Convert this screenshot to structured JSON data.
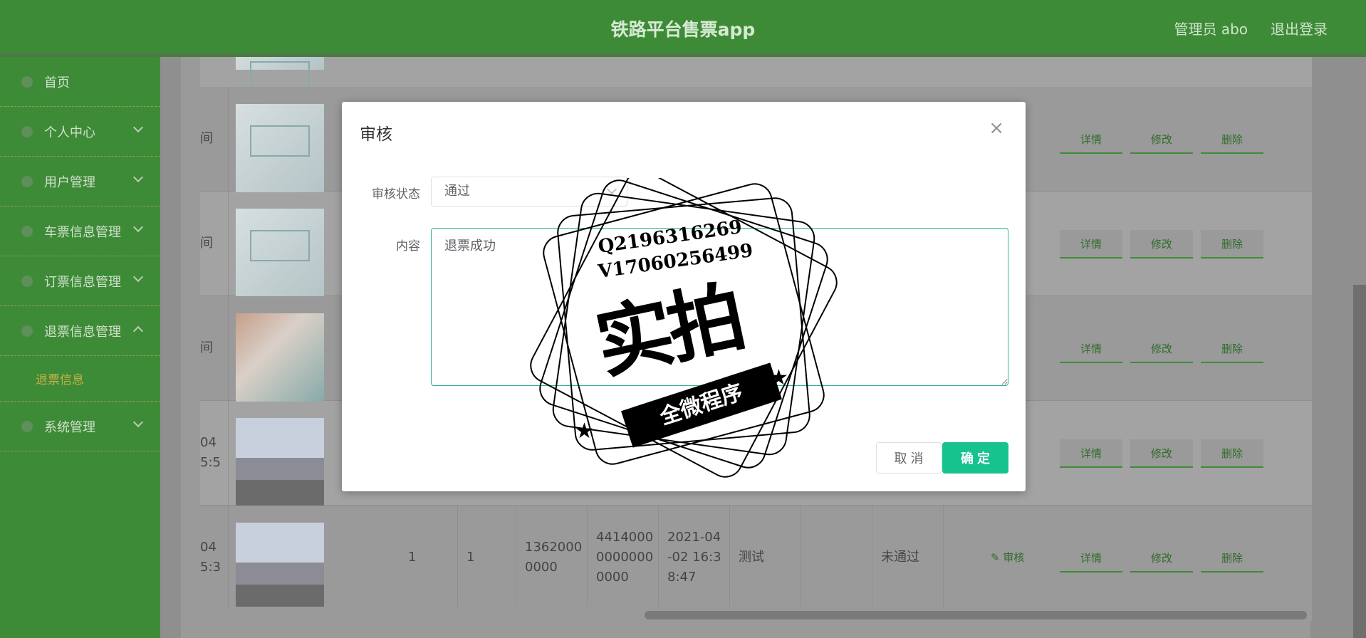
{
  "header": {
    "title": "铁路平台售票app",
    "user": "管理员 abo",
    "logout": "退出登录"
  },
  "sidebar": {
    "items": [
      {
        "label": "首页"
      },
      {
        "label": "个人中心"
      },
      {
        "label": "用户管理"
      },
      {
        "label": "车票信息管理"
      },
      {
        "label": "订票信息管理"
      },
      {
        "label": "退票信息管理"
      },
      {
        "label": "系统管理"
      }
    ],
    "sub": {
      "label": "退票信息"
    }
  },
  "table": {
    "row_labels": [
      "间",
      "间",
      "间",
      "04\n5:5",
      "04\n5:3"
    ],
    "last_row": {
      "c1": "1",
      "c2": "1",
      "phone": "1362000\n0000",
      "idcard": "4414000\n0000000\n0000",
      "time": "2021-04\n-02 16:3\n8:47",
      "note": "测试",
      "status": "未通过",
      "audit": "审核"
    },
    "actions": {
      "detail": "详情",
      "edit": "修改",
      "delete": "删除"
    }
  },
  "modal": {
    "title": "审核",
    "status_label": "审核状态",
    "status_value": "通过",
    "content_label": "内容",
    "content_value": "退票成功",
    "cancel": "取 消",
    "ok": "确 定"
  },
  "watermark": {
    "line1": "Q2196316269",
    "line2": "V17060256499",
    "big": "实拍",
    "banner": "全微程序"
  }
}
